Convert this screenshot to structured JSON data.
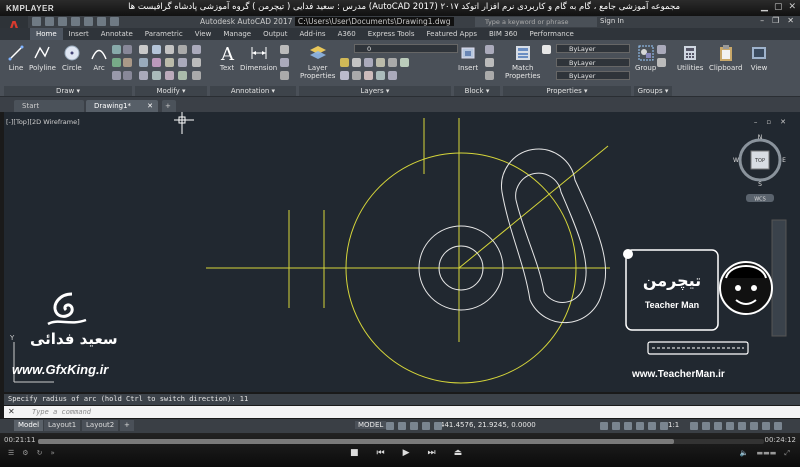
{
  "player": {
    "name": "KMPLAYER",
    "video_title": "مجموعه آموزشی جامع ، گام به گام و کاربردی نرم افزار اتوکد ۲۰۱۷ (AutoCAD 2017) مدرس : سعید فدایی ( تیچرمن ) گروه آموزشی پادشاه گرافیست ها",
    "time_current": "00:21:11",
    "time_total": "00:24:12",
    "progress": 0.8755
  },
  "app": {
    "logo_letter": "A",
    "title_prefix": "Autodesk AutoCAD 2017",
    "title_path": "C:\\Users\\User\\Documents\\Drawing1.dwg",
    "search_placeholder": "Type a keyword or phrase",
    "signin": "Sign In"
  },
  "ribbon_tabs": [
    "Home",
    "Insert",
    "Annotate",
    "Parametric",
    "View",
    "Manage",
    "Output",
    "Add-ins",
    "A360",
    "Express Tools",
    "Featured Apps",
    "BIM 360",
    "Performance"
  ],
  "draw_tools": [
    "Line",
    "Polyline",
    "Circle",
    "Arc"
  ],
  "annotation_tools": [
    "Text",
    "Dimension"
  ],
  "layer_tool": [
    "Layer",
    "Properties"
  ],
  "block_tool": "Insert",
  "props_tool": [
    "Match",
    "Properties"
  ],
  "group_tool": "Group",
  "util_tools": [
    "Utilities",
    "Clipboard",
    "View"
  ],
  "layer_combo": "0",
  "bylayer": [
    "ByLayer",
    "ByLayer",
    "ByLayer"
  ],
  "panels": [
    "Draw",
    "Modify",
    "Annotation",
    "Layers",
    "Block",
    "Properties",
    "Groups"
  ],
  "file_tabs": [
    "Start",
    "Drawing1*"
  ],
  "viewport_label": "[-][Top][2D Wireframe]",
  "viewcube": {
    "n": "N",
    "s": "S",
    "e": "E",
    "w": "W",
    "top": "TOP",
    "wcs": "WCS"
  },
  "command": {
    "history": "Specify radius of arc (hold Ctrl to switch direction): 11",
    "placeholder": "Type a command"
  },
  "layout_tabs": [
    "Model",
    "Layout1",
    "Layout2"
  ],
  "status": {
    "coords": "441.4576, 21.9245, 0.0000",
    "model": "MODEL",
    "scale": "1:1"
  },
  "watermark": {
    "name": "سعید فدائی",
    "url_left": "www.GfxKing.ir",
    "url_right": "www.TeacherMan.ir",
    "badge_fa": "تیچرمن",
    "badge_en": "Teacher Man"
  },
  "colors": {
    "canvas": "#212830",
    "yellow_lines": "#d6d63a",
    "white_lines": "#e6e6e6"
  }
}
